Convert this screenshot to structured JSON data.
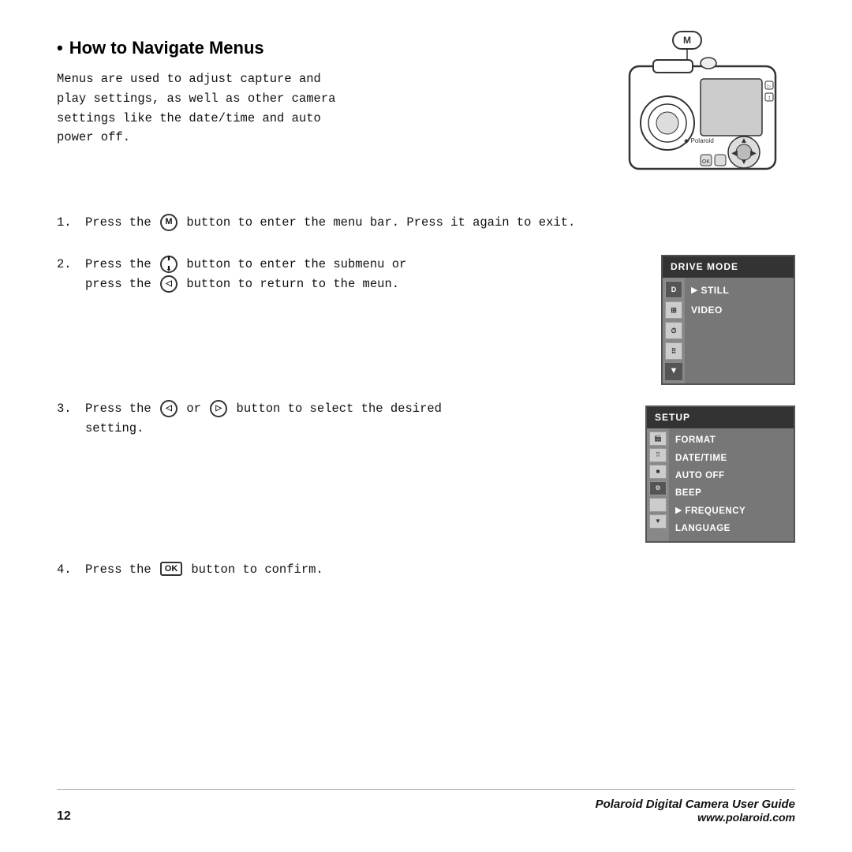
{
  "page": {
    "title": "How to Navigate Menus",
    "intro": "Menus are used to adjust capture and\nplay settings, as well as other camera\nsettings like the date/time and auto\npower off.",
    "steps": [
      {
        "number": "1.",
        "text_before": "Press the",
        "icon": "M",
        "text_after": "button to enter the menu bar. Press it again to exit."
      },
      {
        "number": "2.",
        "text_before": "Press the",
        "icon": "up-down",
        "text_after": "button to enter the submenu or press the",
        "icon2": "left",
        "text_after2": "button to return to the meun."
      },
      {
        "number": "3.",
        "text_before": "Press the",
        "icon": "left-nav",
        "text_middle": "or",
        "icon2": "right-nav",
        "text_after": "button to select the desired setting."
      },
      {
        "number": "4.",
        "text_before": "Press the",
        "icon": "OK",
        "text_after": "button to confirm."
      }
    ],
    "drive_mode_menu": {
      "header": "DRIVE MODE",
      "icons": [
        "D",
        "⊞",
        "⊟",
        "⠿",
        "▼"
      ],
      "items": [
        "STILL",
        "VIDEO"
      ],
      "selected": "STILL"
    },
    "setup_menu": {
      "header": "SETUP",
      "icons": [
        "🎬",
        "⠿",
        "■",
        "⚙",
        "▼"
      ],
      "items": [
        "FORMAT",
        "DATE/TIME",
        "AUTO OFF",
        "BEEP",
        "FREQUENCY",
        "LANGUAGE"
      ],
      "highlighted": "FREQUENCY"
    },
    "footer": {
      "page_number": "12",
      "brand_line1": "Polaroid Digital Camera User Guide",
      "brand_line2": "www.polaroid.com"
    }
  }
}
